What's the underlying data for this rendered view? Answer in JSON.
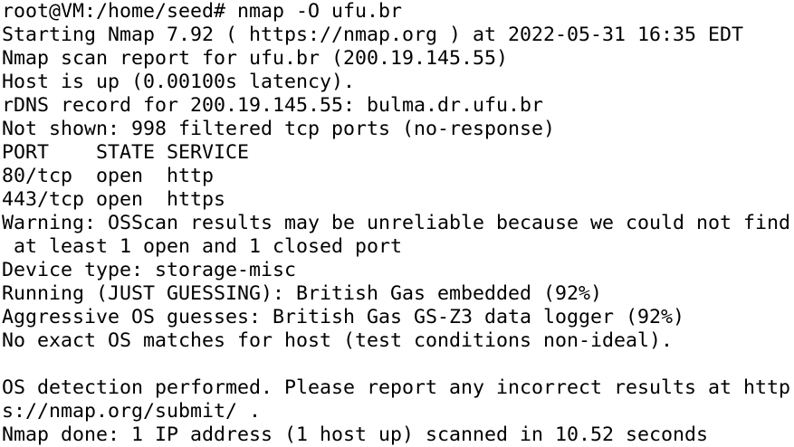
{
  "terminal": {
    "lines": [
      "root@VM:/home/seed# nmap -O ufu.br",
      "Starting Nmap 7.92 ( https://nmap.org ) at 2022-05-31 16:35 EDT",
      "Nmap scan report for ufu.br (200.19.145.55)",
      "Host is up (0.00100s latency).",
      "rDNS record for 200.19.145.55: bulma.dr.ufu.br",
      "Not shown: 998 filtered tcp ports (no-response)",
      "PORT    STATE SERVICE",
      "80/tcp  open  http",
      "443/tcp open  https",
      "Warning: OSScan results may be unreliable because we could not find",
      " at least 1 open and 1 closed port",
      "Device type: storage-misc",
      "Running (JUST GUESSING): British Gas embedded (92%)",
      "Aggressive OS guesses: British Gas GS-Z3 data logger (92%)",
      "No exact OS matches for host (test conditions non-ideal).",
      "",
      "OS detection performed. Please report any incorrect results at http",
      "s://nmap.org/submit/ .",
      "Nmap done: 1 IP address (1 host up) scanned in 10.52 seconds"
    ]
  }
}
